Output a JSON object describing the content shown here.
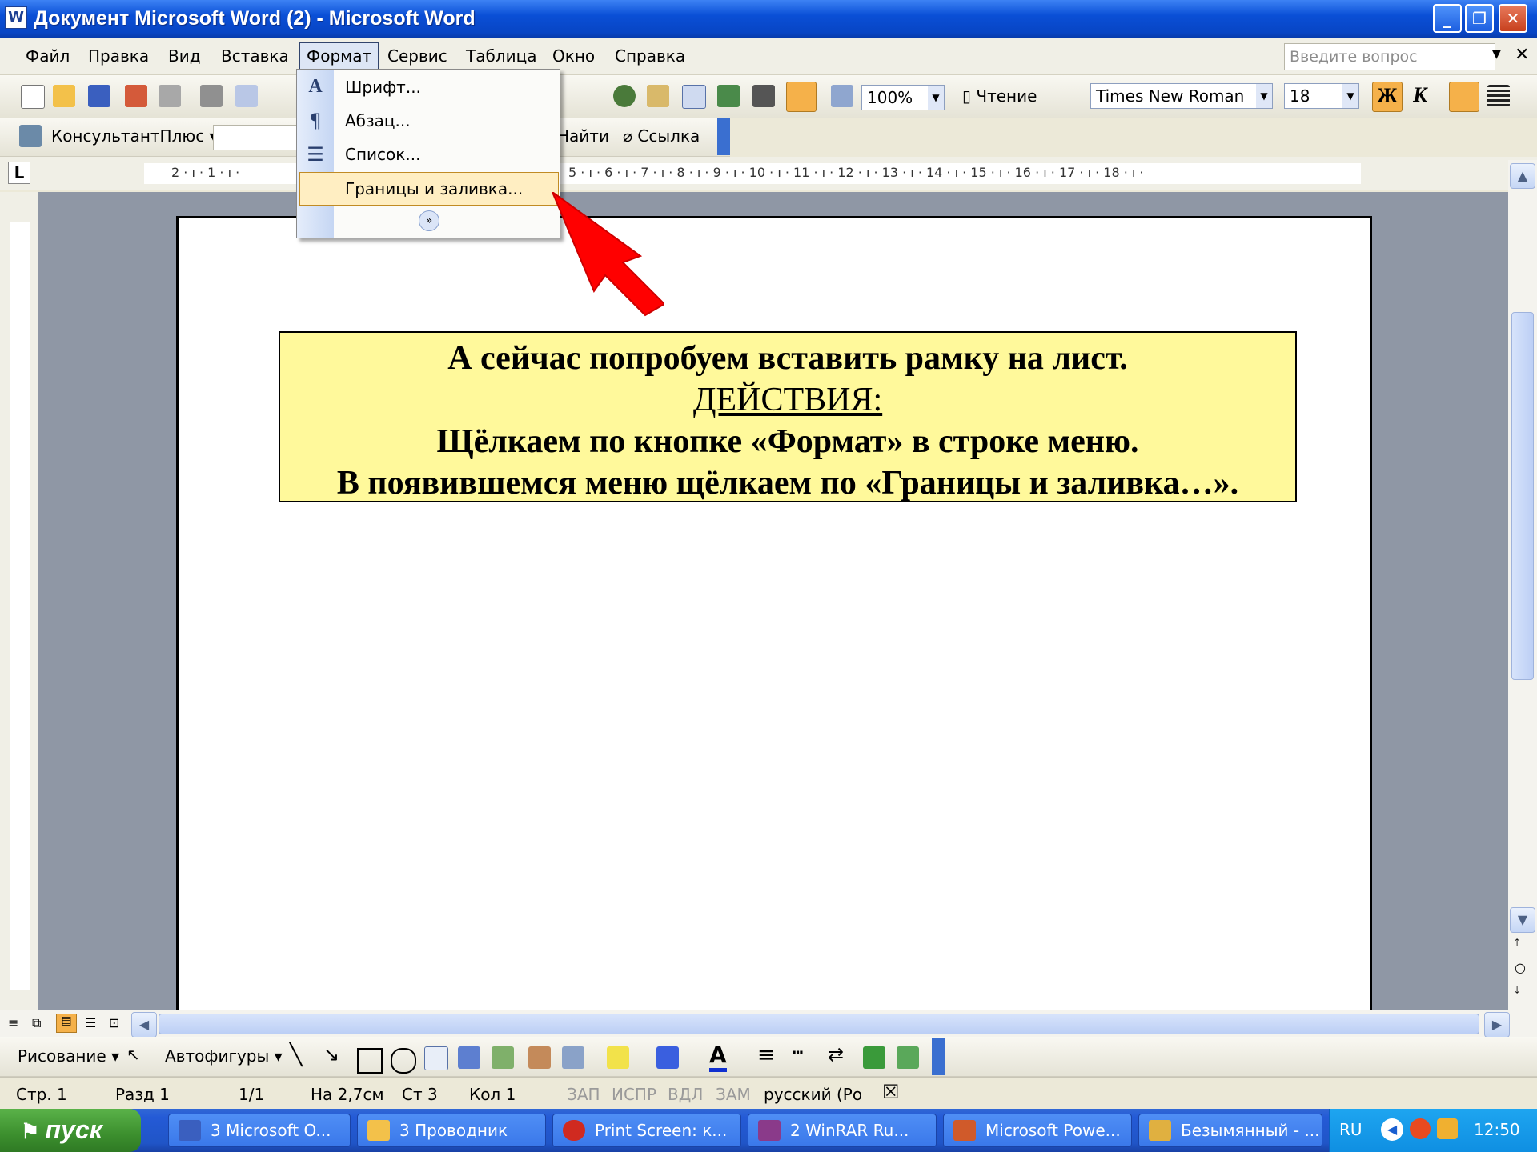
{
  "window": {
    "title": "Документ Microsoft Word (2) - Microsoft Word"
  },
  "menu": {
    "items": [
      "Файл",
      "Правка",
      "Вид",
      "Вставка",
      "Формат",
      "Сервис",
      "Таблица",
      "Окно",
      "Справка"
    ],
    "active": "Формат",
    "help_placeholder": "Введите вопрос"
  },
  "toolbar_standard": {
    "zoom": "100%",
    "reading": "Чтение"
  },
  "toolbar_format": {
    "font": "Times New Roman",
    "size": "18",
    "bold": "Ж",
    "italic": "К"
  },
  "toolbar_consultant": {
    "name": "КонсультантПлюс",
    "find": "Найти",
    "link": "Ссылка"
  },
  "format_menu": {
    "items": [
      "Шрифт...",
      "Абзац...",
      "Список...",
      "Границы и заливка..."
    ],
    "highlighted": "Границы и заливка..."
  },
  "ruler": {
    "labels": "2 · ı · 1 · ı ·",
    "right_labels": "5 · ı · 6 · ı · 7 · ı · 8 · ı · 9 · ı · 10 · ı · 11 · ı · 12 · ı · 13 · ı · 14 · ı · 15 · ı · 16 · ı · 17 · ı · 18 · ı ·"
  },
  "document": {
    "line1": "А сейчас попробуем вставить рамку на лист.",
    "line2": "ДЕЙСТВИЯ:",
    "line3": "Щёлкаем по кнопке «Формат» в строке меню.",
    "line4": "В появившемся меню щёлкаем по «Границы и заливка…»."
  },
  "drawing_toolbar": {
    "drawing": "Рисование",
    "autoshapes": "Автофигуры"
  },
  "status": {
    "page": "Стр. 1",
    "section": "Разд 1",
    "pages": "1/1",
    "at": "На 2,7см",
    "line": "Ст 3",
    "col": "Кол 1",
    "rec": "ЗАП",
    "trk": "ИСПР",
    "ext": "ВДЛ",
    "ovr": "ЗАМ",
    "lang": "русский (Ро"
  },
  "taskbar": {
    "start": "пуск",
    "tasks": [
      "3 Microsoft O...",
      "3 Проводник",
      "Print Screen: к...",
      "2 WinRAR Ru...",
      "Microsoft Powe...",
      "Безымянный - ..."
    ],
    "lang": "RU",
    "time": "12:50"
  },
  "colors": {
    "titlebar": "#0a4fd6",
    "highlight_box": "#fff99b",
    "menu_highlight": "#ffeec2",
    "arrow": "#ff0000"
  }
}
